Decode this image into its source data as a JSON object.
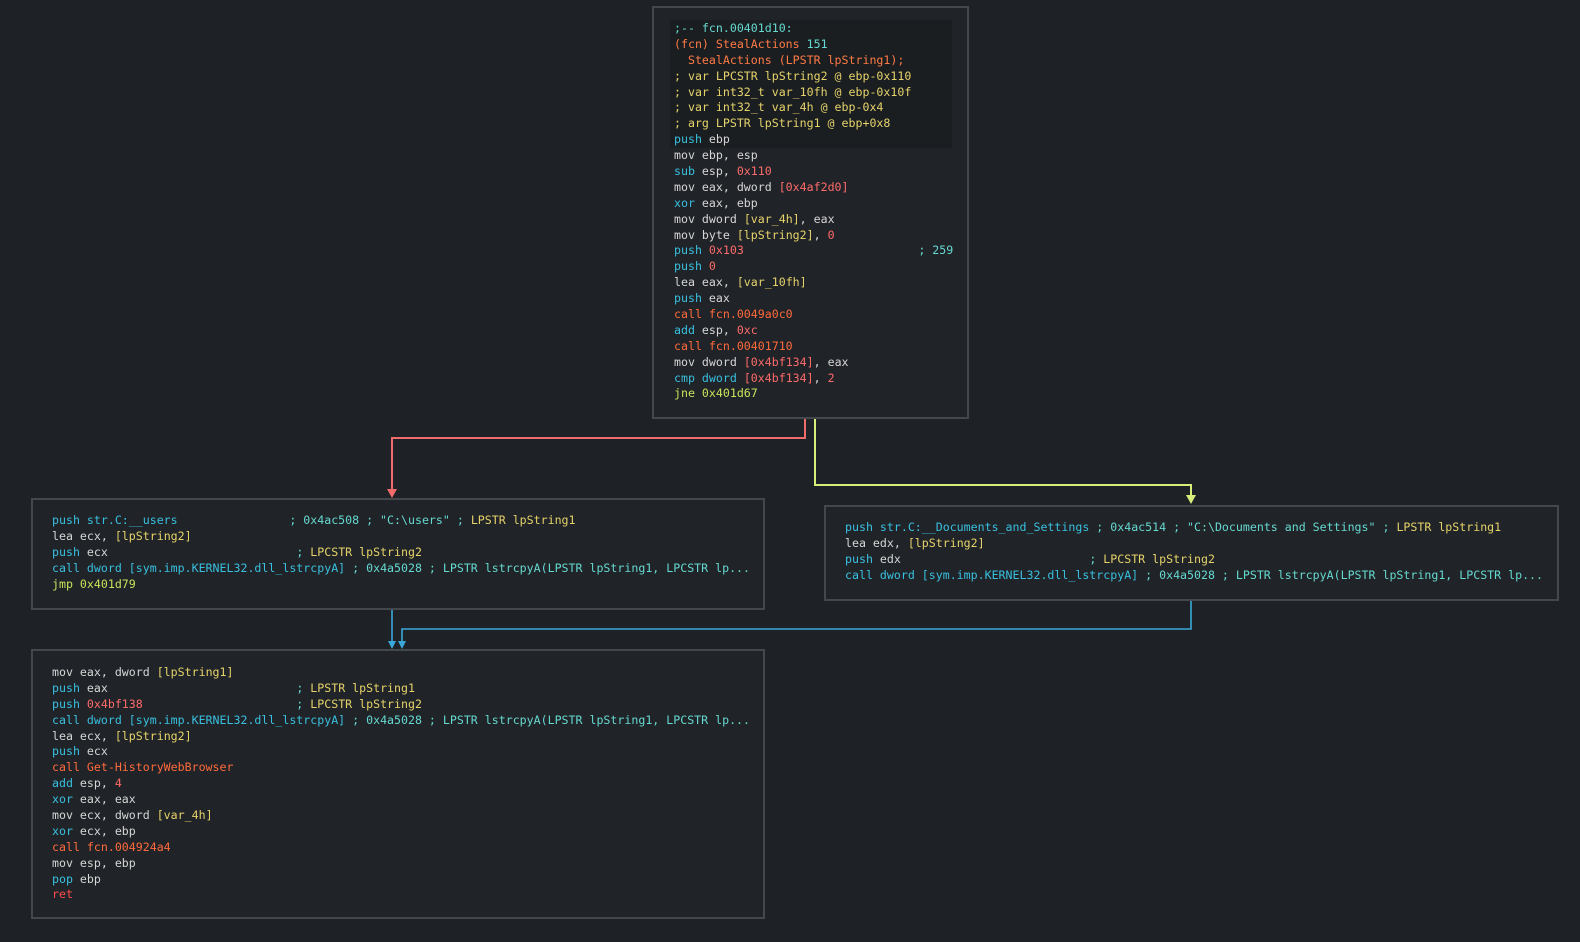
{
  "edge_colors": {
    "true_branch": "#f06b6b",
    "false_branch": "#d6ee7a",
    "jump": "#3aa8d8",
    "merge": "#3aa8d8"
  },
  "nodes": {
    "entry": {
      "lines": [
        [
          {
            "t": ";-- fcn.00401d10:",
            "c": "cm"
          }
        ],
        [
          {
            "t": "(fcn) StealActions ",
            "c": "fn"
          },
          {
            "t": "151",
            "c": "cm"
          }
        ],
        [
          {
            "t": "  StealActions (LPSTR lpString1);",
            "c": "fn"
          }
        ],
        [
          {
            "t": "; var LPCSTR lpString2 @ ebp-0x110",
            "c": "yl"
          }
        ],
        [
          {
            "t": "; var int32_t var_10fh @ ebp-0x10f",
            "c": "yl"
          }
        ],
        [
          {
            "t": "; var int32_t var_4h @ ebp-0x4",
            "c": "yl"
          }
        ],
        [
          {
            "t": "; arg LPSTR lpString1 @ ebp+0x8",
            "c": "yl"
          }
        ],
        [
          {
            "t": "push ",
            "c": "dw"
          },
          {
            "t": "ebp",
            "c": "sp"
          }
        ],
        [
          {
            "t": "mov ebp, esp",
            "c": "mn"
          }
        ],
        [
          {
            "t": "sub ",
            "c": "dw"
          },
          {
            "t": "esp, ",
            "c": "sp"
          },
          {
            "t": "0x110",
            "c": "nm"
          }
        ],
        [
          {
            "t": "mov eax, dword ",
            "c": "mn"
          },
          {
            "t": "[0x4af2d0]",
            "c": "nm"
          }
        ],
        [
          {
            "t": "xor ",
            "c": "dw"
          },
          {
            "t": "eax, ebp",
            "c": "sp"
          }
        ],
        [
          {
            "t": "mov dword ",
            "c": "mn"
          },
          {
            "t": "[var_4h]",
            "c": "yl"
          },
          {
            "t": ", eax",
            "c": "sp"
          }
        ],
        [
          {
            "t": "mov byte ",
            "c": "mn"
          },
          {
            "t": "[lpString2]",
            "c": "yl"
          },
          {
            "t": ", ",
            "c": "sp"
          },
          {
            "t": "0",
            "c": "nm"
          }
        ],
        [
          {
            "t": "push ",
            "c": "dw"
          },
          {
            "t": "0x103",
            "c": "nm"
          },
          {
            "t": "                         ; 259",
            "c": "cm"
          }
        ],
        [
          {
            "t": "push ",
            "c": "dw"
          },
          {
            "t": "0",
            "c": "nm"
          }
        ],
        [
          {
            "t": "lea eax, ",
            "c": "mn"
          },
          {
            "t": "[var_10fh]",
            "c": "yl"
          }
        ],
        [
          {
            "t": "push ",
            "c": "dw"
          },
          {
            "t": "eax",
            "c": "sp"
          }
        ],
        [
          {
            "t": "call fcn.0049a0c0",
            "c": "cl"
          }
        ],
        [
          {
            "t": "add ",
            "c": "dw"
          },
          {
            "t": "esp, ",
            "c": "sp"
          },
          {
            "t": "0xc",
            "c": "nm"
          }
        ],
        [
          {
            "t": "call fcn.00401710",
            "c": "cl"
          }
        ],
        [
          {
            "t": "mov dword ",
            "c": "mn"
          },
          {
            "t": "[0x4bf134]",
            "c": "nm"
          },
          {
            "t": ", eax",
            "c": "sp"
          }
        ],
        [
          {
            "t": "cmp dword ",
            "c": "dw"
          },
          {
            "t": "[0x4bf134]",
            "c": "nm"
          },
          {
            "t": ", ",
            "c": "sp"
          },
          {
            "t": "2",
            "c": "nm"
          }
        ],
        [
          {
            "t": "jne 0x401d67",
            "c": "jm"
          }
        ]
      ]
    },
    "users": {
      "lines": [
        [
          {
            "t": "push str.C:__users",
            "c": "st"
          },
          {
            "t": "                ; 0x4ac508 ; \"C:\\users\" ; ",
            "c": "cm"
          },
          {
            "t": "LPSTR lpString1",
            "c": "yl"
          }
        ],
        [
          {
            "t": "lea ecx, ",
            "c": "mn"
          },
          {
            "t": "[lpString2]",
            "c": "yl"
          }
        ],
        [
          {
            "t": "push ",
            "c": "dw"
          },
          {
            "t": "ecx",
            "c": "sp"
          },
          {
            "t": "                           ; ",
            "c": "cm"
          },
          {
            "t": "LPCSTR lpString2",
            "c": "yl"
          }
        ],
        [
          {
            "t": "call dword ",
            "c": "st"
          },
          {
            "t": "[sym.imp.KERNEL32.dll_lstrcpyA]",
            "c": "st"
          },
          {
            "t": " ; 0x4a5028 ; LPSTR lstrcpyA(LPSTR lpString1, LPCSTR lp...",
            "c": "cm"
          }
        ],
        [
          {
            "t": "jmp 0x401d79",
            "c": "jm"
          }
        ]
      ]
    },
    "docs": {
      "lines": [
        [
          {
            "t": "push str.C:__Documents_and_Settings",
            "c": "st"
          },
          {
            "t": " ; 0x4ac514 ; \"C:\\Documents and Settings\" ; ",
            "c": "cm"
          },
          {
            "t": "LPSTR lpString1",
            "c": "yl"
          }
        ],
        [
          {
            "t": "lea edx, ",
            "c": "mn"
          },
          {
            "t": "[lpString2]",
            "c": "yl"
          }
        ],
        [
          {
            "t": "push ",
            "c": "dw"
          },
          {
            "t": "edx",
            "c": "sp"
          },
          {
            "t": "                           ; ",
            "c": "cm"
          },
          {
            "t": "LPCSTR lpString2",
            "c": "yl"
          }
        ],
        [
          {
            "t": "call dword ",
            "c": "st"
          },
          {
            "t": "[sym.imp.KERNEL32.dll_lstrcpyA]",
            "c": "st"
          },
          {
            "t": " ; 0x4a5028 ; LPSTR lstrcpyA(LPSTR lpString1, LPCSTR lp...",
            "c": "cm"
          }
        ]
      ]
    },
    "final": {
      "lines": [
        [
          {
            "t": "mov eax, dword ",
            "c": "mn"
          },
          {
            "t": "[lpString1]",
            "c": "yl"
          }
        ],
        [
          {
            "t": "push ",
            "c": "dw"
          },
          {
            "t": "eax",
            "c": "sp"
          },
          {
            "t": "                           ; ",
            "c": "cm"
          },
          {
            "t": "LPSTR lpString1",
            "c": "yl"
          }
        ],
        [
          {
            "t": "push ",
            "c": "dw"
          },
          {
            "t": "0x4bf138",
            "c": "nm"
          },
          {
            "t": "                      ; ",
            "c": "cm"
          },
          {
            "t": "LPCSTR lpString2",
            "c": "yl"
          }
        ],
        [
          {
            "t": "call dword ",
            "c": "st"
          },
          {
            "t": "[sym.imp.KERNEL32.dll_lstrcpyA]",
            "c": "st"
          },
          {
            "t": " ; 0x4a5028 ; LPSTR lstrcpyA(LPSTR lpString1, LPCSTR lp...",
            "c": "cm"
          }
        ],
        [
          {
            "t": "lea ecx, ",
            "c": "mn"
          },
          {
            "t": "[lpString2]",
            "c": "yl"
          }
        ],
        [
          {
            "t": "push ",
            "c": "dw"
          },
          {
            "t": "ecx",
            "c": "sp"
          }
        ],
        [
          {
            "t": "call Get-HistoryWebBrowser",
            "c": "cl"
          }
        ],
        [
          {
            "t": "add ",
            "c": "dw"
          },
          {
            "t": "esp, ",
            "c": "sp"
          },
          {
            "t": "4",
            "c": "nm"
          }
        ],
        [
          {
            "t": "xor ",
            "c": "dw"
          },
          {
            "t": "eax, eax",
            "c": "sp"
          }
        ],
        [
          {
            "t": "mov ecx, dword ",
            "c": "mn"
          },
          {
            "t": "[var_4h]",
            "c": "yl"
          }
        ],
        [
          {
            "t": "xor ",
            "c": "dw"
          },
          {
            "t": "ecx, ebp",
            "c": "sp"
          }
        ],
        [
          {
            "t": "call fcn.004924a4",
            "c": "cl"
          }
        ],
        [
          {
            "t": "mov esp, ebp",
            "c": "mn"
          }
        ],
        [
          {
            "t": "pop ",
            "c": "dw"
          },
          {
            "t": "ebp",
            "c": "sp"
          }
        ],
        [
          {
            "t": "ret",
            "c": "rt"
          }
        ]
      ]
    }
  }
}
